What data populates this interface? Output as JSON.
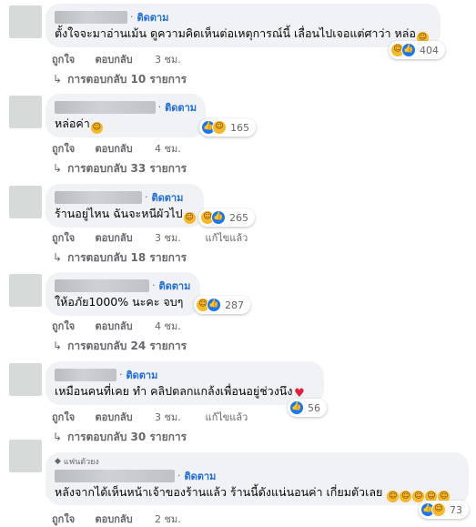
{
  "follow_label": "ติดตาม",
  "comments": [
    {
      "text": "ตั้งใจจะมาอ่านเม้น ดูความคิดเห็นต่อเหตุการณ์นี้ เลื่อนไปเจอแต่ศาว่า หล่อ",
      "reaction_count": "404",
      "like_label": "ถูกใจ",
      "reply_label": "ตอบกลับ",
      "time": "3 ชม.",
      "replies": "การตอบกลับ 10 รายการ"
    },
    {
      "text": "หล่อค่า",
      "reaction_count": "165",
      "like_label": "ถูกใจ",
      "reply_label": "ตอบกลับ",
      "time": "4 ชม.",
      "replies": "การตอบกลับ 33 รายการ"
    },
    {
      "text": "ร้านอยู่ไหน ฉันจะหนีผัวไป",
      "reaction_count": "265",
      "like_label": "ถูกใจ",
      "reply_label": "ตอบกลับ",
      "time": "3 ชม.",
      "edited": "แก้ไขแล้ว",
      "replies": "การตอบกลับ 18 รายการ"
    },
    {
      "text": "ให้อภัย1000% นะคะ จบๆ",
      "reaction_count": "287",
      "like_label": "ถูกใจ",
      "reply_label": "ตอบกลับ",
      "time": "4 ชม.",
      "replies": "การตอบกลับ 24 รายการ"
    },
    {
      "text": "เหมือนคนที่เคย ทำ คลิปตลกแกล้งเพื่อนอยู่ช่วงนึง",
      "reaction_count": "56",
      "like_label": "ถูกใจ",
      "reply_label": "ตอบกลับ",
      "time": "3 ชม.",
      "edited": "แก้ไขแล้ว",
      "replies": "การตอบกลับ 30 รายการ"
    },
    {
      "fan_badge": "แฟนตัวยง",
      "text": "หลังจากได้เห็นหน้าเจ้าของร้านแล้ว ร้านนี้ดังแน่นอนค่า เกี่ยมตัวเลย",
      "reaction_count": "73",
      "like_label": "ถูกใจ",
      "reply_label": "ตอบกลับ",
      "time": "2 ชม."
    }
  ]
}
